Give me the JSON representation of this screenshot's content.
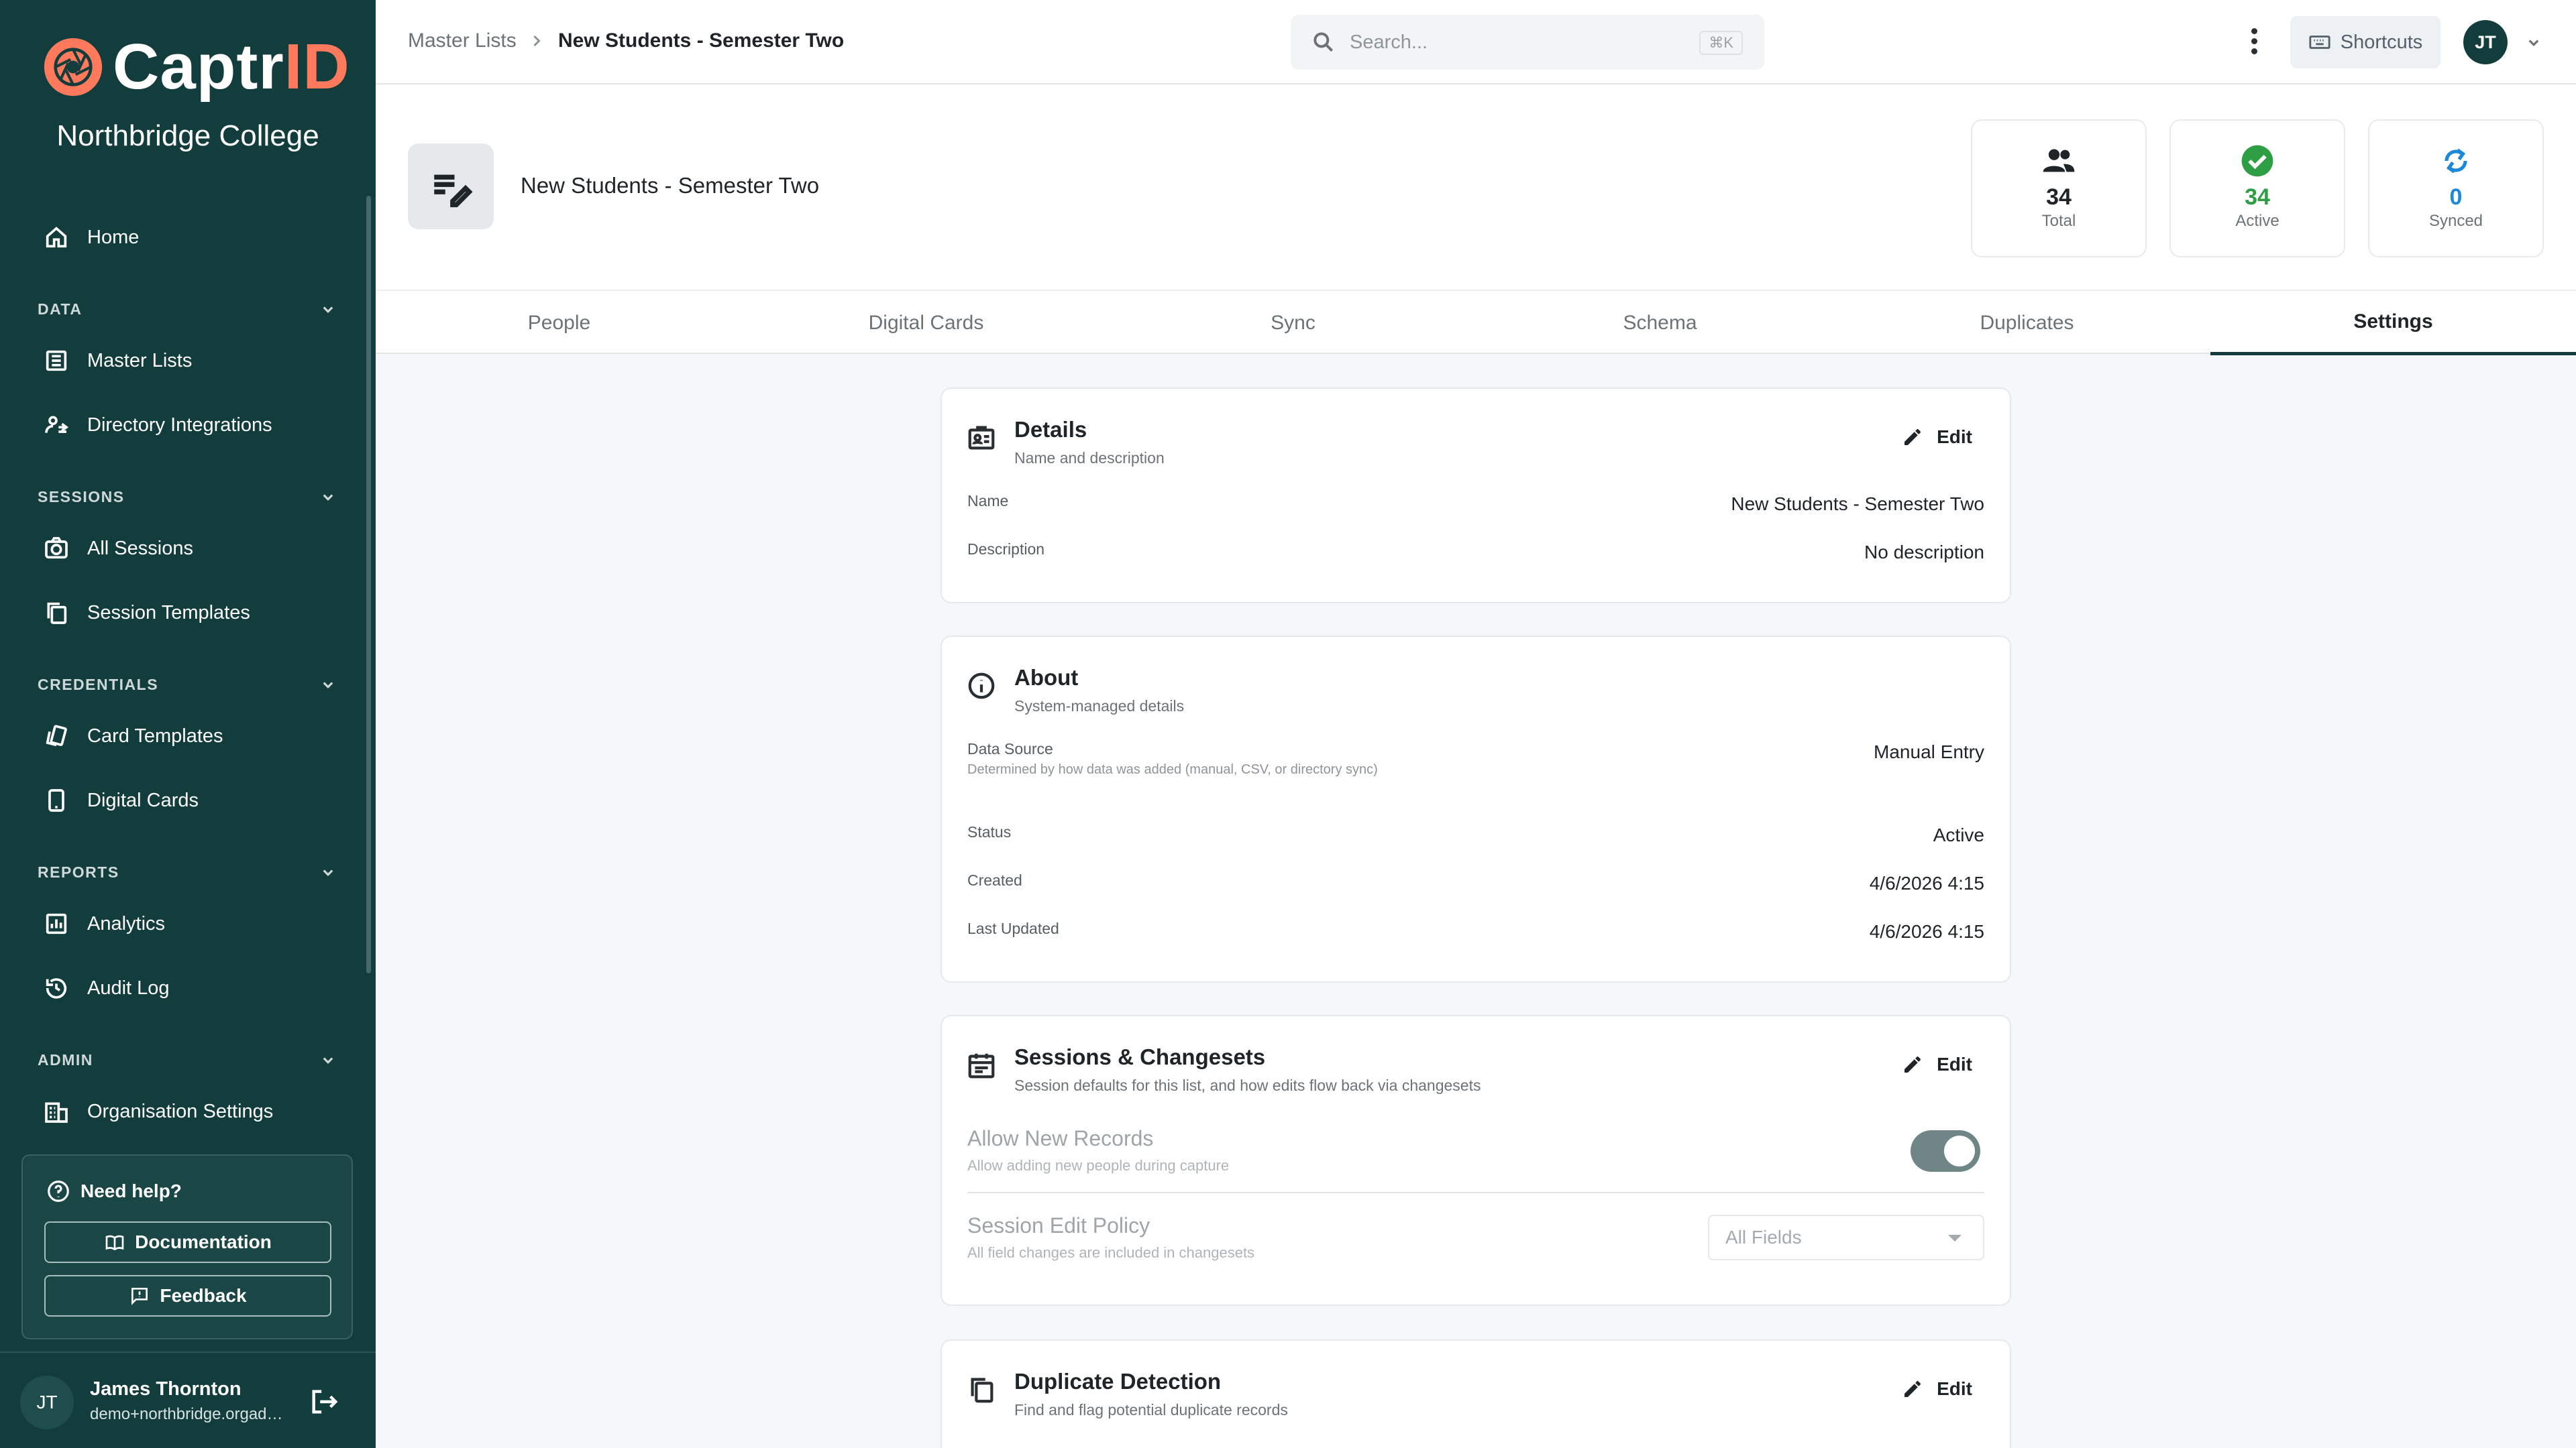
{
  "brand": {
    "name_part1": "Captr",
    "name_part2": "ID",
    "org": "Northbridge College"
  },
  "sidebar": {
    "home": "Home",
    "sections": {
      "data": "DATA",
      "sessions": "SESSIONS",
      "credentials": "CREDENTIALS",
      "reports": "REPORTS",
      "admin": "ADMIN"
    },
    "items": {
      "master_lists": "Master Lists",
      "directory_integrations": "Directory Integrations",
      "all_sessions": "All Sessions",
      "session_templates": "Session Templates",
      "card_templates": "Card Templates",
      "digital_cards": "Digital Cards",
      "analytics": "Analytics",
      "audit_log": "Audit Log",
      "organisation_settings": "Organisation Settings"
    },
    "help": {
      "title": "Need help?",
      "documentation": "Documentation",
      "feedback": "Feedback"
    },
    "user": {
      "initials": "JT",
      "name": "James Thornton",
      "email": "demo+northbridge.orgadmin@captrid.com"
    }
  },
  "topbar": {
    "breadcrumb_parent": "Master Lists",
    "breadcrumb_current": "New Students - Semester Two",
    "search_placeholder": "Search...",
    "search_shortcut": "⌘K",
    "shortcuts_label": "Shortcuts",
    "avatar_initials": "JT"
  },
  "header": {
    "title": "New Students - Semester Two",
    "stats": [
      {
        "value": "34",
        "label": "Total",
        "color": "#1e2428"
      },
      {
        "value": "34",
        "label": "Active",
        "color": "#2e9e44"
      },
      {
        "value": "0",
        "label": "Synced",
        "color": "#1e88d8"
      }
    ]
  },
  "tabs": [
    "People",
    "Digital Cards",
    "Sync",
    "Schema",
    "Duplicates",
    "Settings"
  ],
  "active_tab": "Settings",
  "details": {
    "title": "Details",
    "subtitle": "Name and description",
    "edit": "Edit",
    "name_label": "Name",
    "name_value": "New Students - Semester Two",
    "description_label": "Description",
    "description_value": "No description"
  },
  "about": {
    "title": "About",
    "subtitle": "System-managed details",
    "data_source_label": "Data Source",
    "data_source_help": "Determined by how data was added (manual, CSV, or directory sync)",
    "data_source_value": "Manual Entry",
    "status_label": "Status",
    "status_value": "Active",
    "created_label": "Created",
    "created_value": "4/6/2026 4:15",
    "updated_label": "Last Updated",
    "updated_value": "4/6/2026 4:15"
  },
  "sessions": {
    "title": "Sessions & Changesets",
    "subtitle": "Session defaults for this list, and how edits flow back via changesets",
    "edit": "Edit",
    "allow_new_label": "Allow New Records",
    "allow_new_help": "Allow adding new people during capture",
    "allow_new_on": true,
    "edit_policy_label": "Session Edit Policy",
    "edit_policy_help": "All field changes are included in changesets",
    "edit_policy_value": "All Fields"
  },
  "duplicates": {
    "title": "Duplicate Detection",
    "subtitle": "Find and flag potential duplicate records",
    "edit": "Edit"
  },
  "colors": {
    "sidebar": "#133d3d",
    "accent": "#ff7a5c",
    "active": "#2e9e44",
    "synced": "#1e88d8"
  }
}
